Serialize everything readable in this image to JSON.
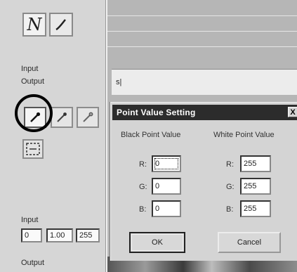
{
  "left_panel": {
    "mode_buttons": [
      {
        "name": "curve-mode",
        "icon": "curve-icon",
        "glyph": "N"
      },
      {
        "name": "pencil-mode",
        "icon": "pencil-icon",
        "glyph": "∕"
      }
    ],
    "input_label": "Input",
    "output_label": "Output",
    "pickers": [
      "black-eyedropper",
      "gray-eyedropper",
      "white-eyedropper"
    ],
    "levels_label": "Input",
    "levels": {
      "black": "0",
      "gamma": "1.00",
      "white": "255"
    },
    "output_label_bottom": "Output"
  },
  "background_window": {
    "field_text": "s|"
  },
  "dialog": {
    "title": "Point Value Setting",
    "close_glyph": "X",
    "black_group": {
      "heading": "Black Point Value",
      "channels": [
        {
          "label": "R:",
          "value": "0"
        },
        {
          "label": "G:",
          "value": "0"
        },
        {
          "label": "B:",
          "value": "0"
        }
      ]
    },
    "white_group": {
      "heading": "White Point Value",
      "channels": [
        {
          "label": "R:",
          "value": "255"
        },
        {
          "label": "G:",
          "value": "255"
        },
        {
          "label": "B:",
          "value": "255"
        }
      ]
    },
    "ok_label": "OK",
    "cancel_label": "Cancel"
  },
  "colors": {
    "title_bar": "#2c2c2c",
    "panel": "#d4d4d4",
    "highlight_ring": "#000000"
  }
}
